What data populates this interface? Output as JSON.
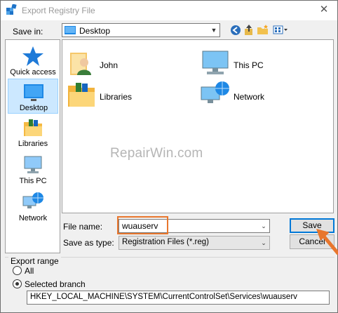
{
  "window": {
    "title": "Export Registry File",
    "close_glyph": "✕"
  },
  "save_in": {
    "label": "Save in:",
    "value": "Desktop"
  },
  "toolbar": {
    "icons": [
      "back-icon",
      "up-folder-icon",
      "new-folder-icon",
      "view-menu-icon"
    ]
  },
  "places": [
    {
      "label": "Quick access",
      "icon": "star-icon"
    },
    {
      "label": "Desktop",
      "icon": "desktop-icon",
      "selected": true
    },
    {
      "label": "Libraries",
      "icon": "libraries-icon"
    },
    {
      "label": "This PC",
      "icon": "computer-icon"
    },
    {
      "label": "Network",
      "icon": "network-icon"
    }
  ],
  "files": [
    {
      "label": "John",
      "icon": "user-folder-icon"
    },
    {
      "label": "This PC",
      "icon": "computer-icon"
    },
    {
      "label": "Libraries",
      "icon": "libraries-icon"
    },
    {
      "label": "Network",
      "icon": "network-icon"
    }
  ],
  "watermark": "RepairWin.com",
  "file_name": {
    "label": "File name:",
    "value": "wuauserv"
  },
  "save_as_type": {
    "label": "Save as type:",
    "value": "Registration Files (*.reg)"
  },
  "buttons": {
    "save": "Save",
    "cancel": "Cancel"
  },
  "export_range": {
    "title": "Export range",
    "all_label": "All",
    "selected_branch_label": "Selected branch",
    "selected": "selected_branch",
    "branch_path": "HKEY_LOCAL_MACHINE\\SYSTEM\\CurrentControlSet\\Services\\wuauserv"
  },
  "colors": {
    "highlight_box": "#e8762d",
    "selection": "#cce8ff",
    "accent": "#0078d7"
  }
}
